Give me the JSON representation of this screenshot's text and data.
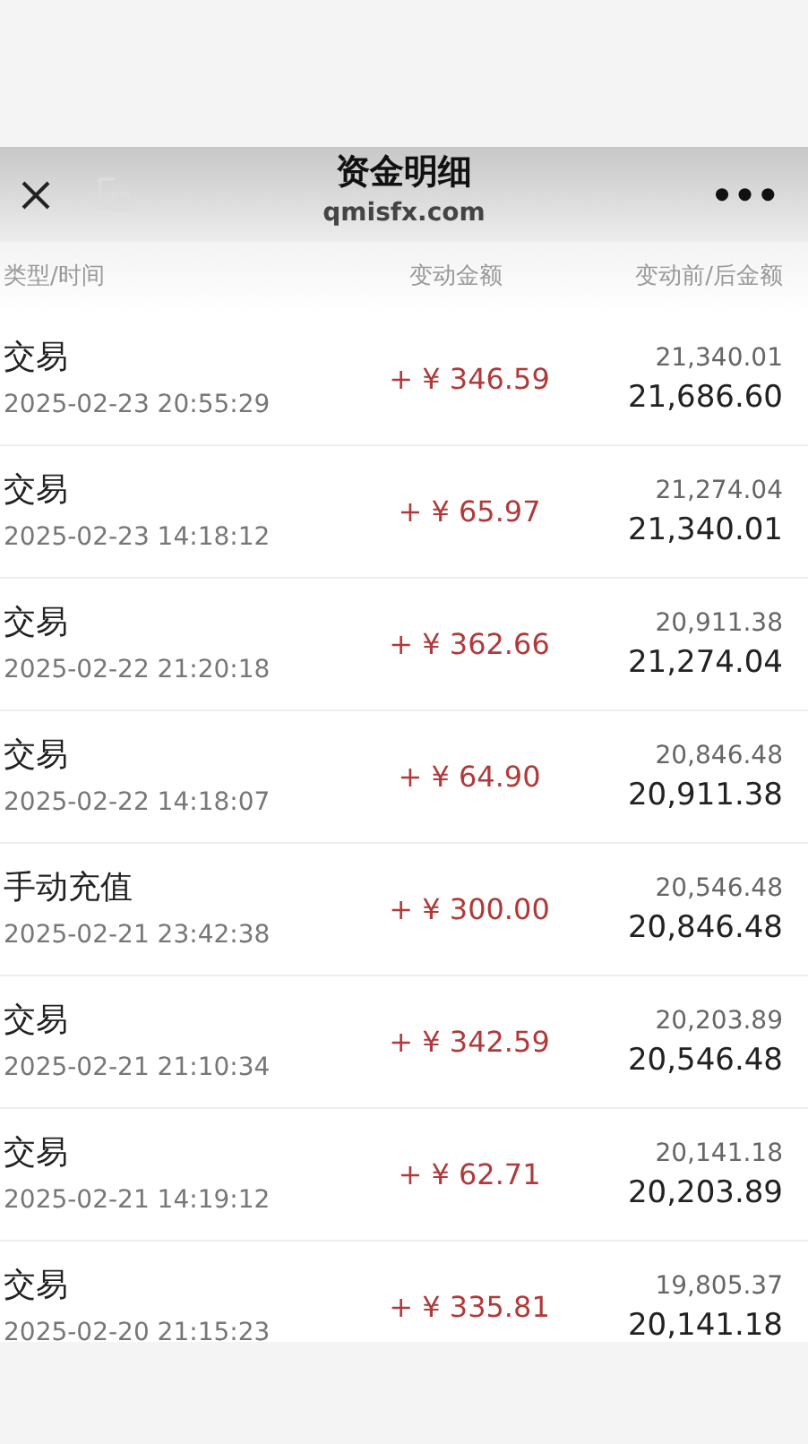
{
  "header": {
    "title": "资金明细",
    "subtitle": "qmisfx.com",
    "more": "•••"
  },
  "columns": [
    "类型/时间",
    "变动金额",
    "变动前/后金额"
  ],
  "rows": [
    {
      "type": "交易",
      "time": "2025-02-23 20:55:29",
      "amount": "+ ¥ 346.59",
      "before": "21,340.01",
      "after": "21,686.60"
    },
    {
      "type": "交易",
      "time": "2025-02-23 14:18:12",
      "amount": "+ ¥ 65.97",
      "before": "21,274.04",
      "after": "21,340.01"
    },
    {
      "type": "交易",
      "time": "2025-02-22 21:20:18",
      "amount": "+ ¥ 362.66",
      "before": "20,911.38",
      "after": "21,274.04"
    },
    {
      "type": "交易",
      "time": "2025-02-22 14:18:07",
      "amount": "+ ¥ 64.90",
      "before": "20,846.48",
      "after": "20,911.38"
    },
    {
      "type": "手动充值",
      "time": "2025-02-21 23:42:38",
      "amount": "+ ¥ 300.00",
      "before": "20,546.48",
      "after": "20,846.48"
    },
    {
      "type": "交易",
      "time": "2025-02-21 21:10:34",
      "amount": "+ ¥ 342.59",
      "before": "20,203.89",
      "after": "20,546.48"
    },
    {
      "type": "交易",
      "time": "2025-02-21 14:19:12",
      "amount": "+ ¥ 62.71",
      "before": "20,141.18",
      "after": "20,203.89"
    },
    {
      "type": "交易",
      "time": "2025-02-20 21:15:23",
      "amount": "+ ¥ 335.81",
      "before": "19,805.37",
      "after": "20,141.18"
    }
  ]
}
